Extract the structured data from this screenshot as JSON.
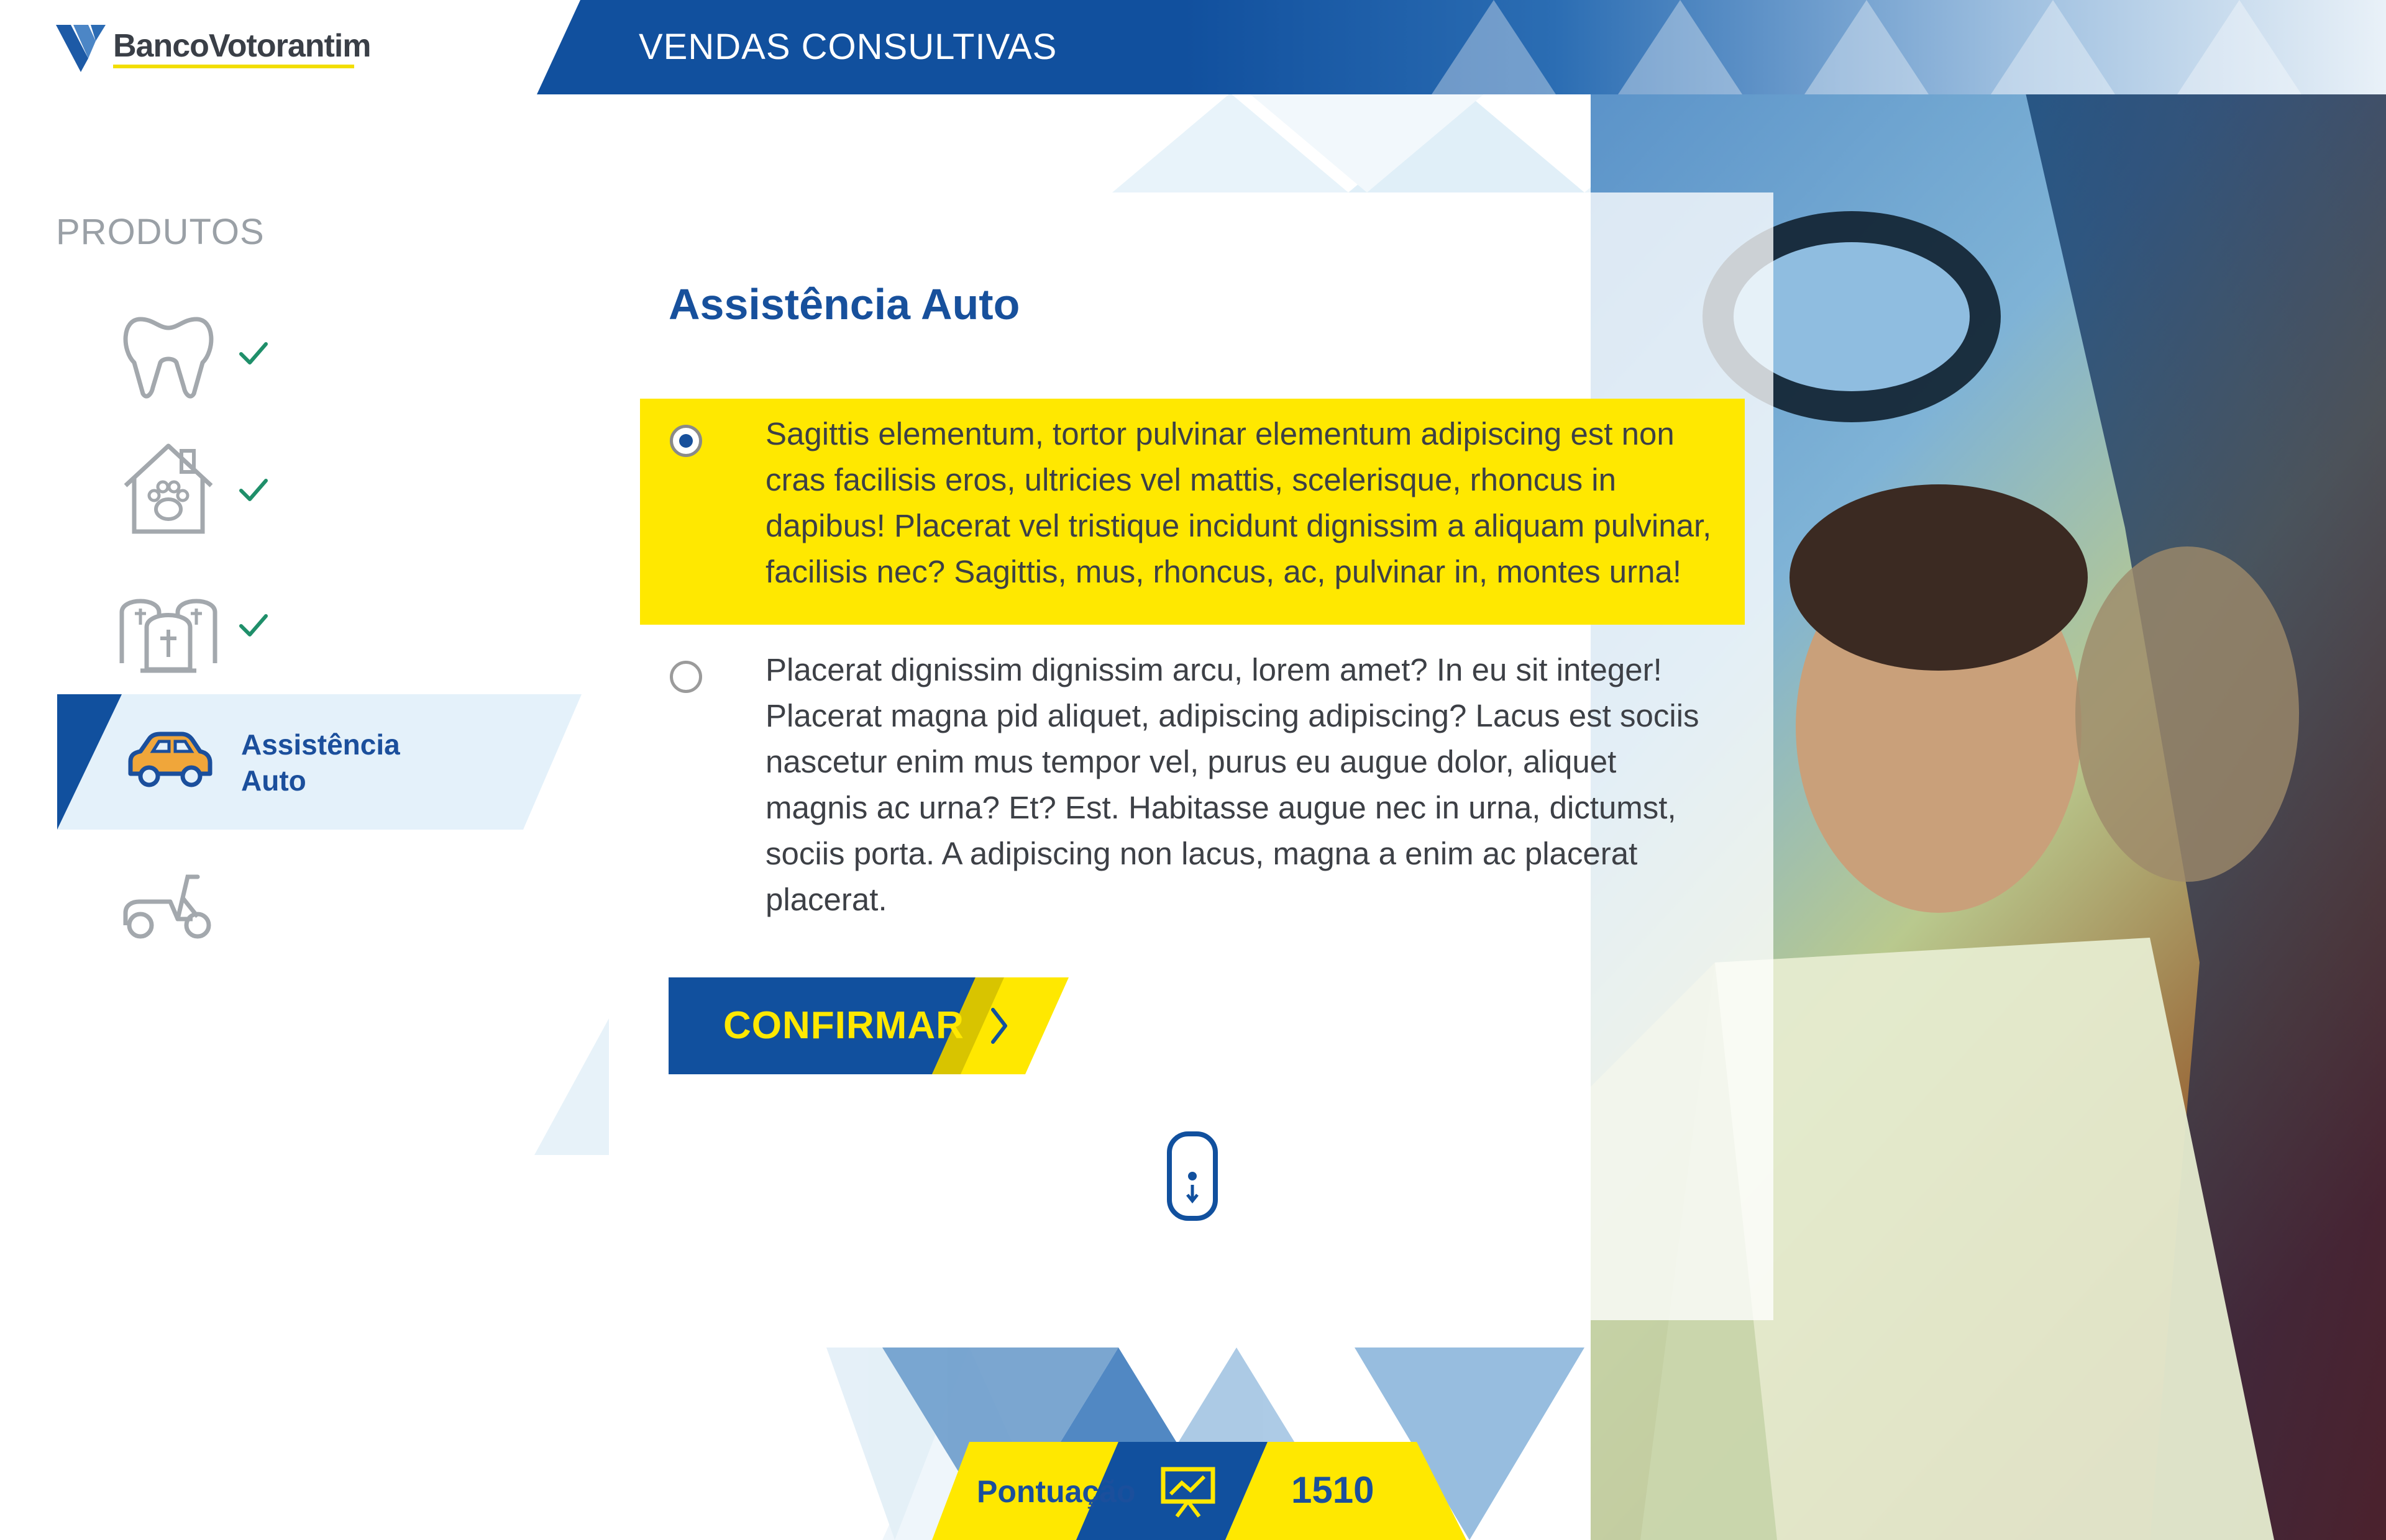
{
  "app": {
    "brand": "BancoVotorantim",
    "title": "VENDAS CONSULTIVAS"
  },
  "sidebar": {
    "section_label": "PRODUTOS",
    "items": [
      {
        "icon": "tooth-icon",
        "completed": true
      },
      {
        "icon": "pet-house-icon",
        "completed": true
      },
      {
        "icon": "tombstones-icon",
        "completed": true
      },
      {
        "icon": "car-icon",
        "label": "Assistência Auto",
        "label_line1": "Assistência",
        "label_line2": "Auto",
        "active": true
      },
      {
        "icon": "scooter-icon",
        "completed": false
      }
    ]
  },
  "question": {
    "title": "Assistência Auto",
    "options": [
      {
        "text": "Sagittis elementum, tortor pulvinar elementum adipiscing est non cras facilisis eros, ultricies vel mattis, scelerisque, rhoncus in dapibus! Placerat vel tristique incidunt dignissim a aliquam pulvinar, facilisis nec? Sagittis, mus, rhoncus, ac, pulvinar in, montes urna!",
        "selected": true
      },
      {
        "text": "Placerat dignissim dignissim arcu, lorem amet? In eu sit integer! Placerat magna pid aliquet, adipiscing adipiscing? Lacus est sociis nascetur enim mus tempor vel, purus eu augue dolor, aliquet magnis ac urna? Et? Est. Habitasse augue nec in urna, dictumst, sociis porta. A adipiscing non lacus, magna a enim ac placerat placerat.",
        "selected": false
      }
    ],
    "confirm_label": "CONFIRMAR"
  },
  "score": {
    "label": "Pontuação",
    "value": "1510"
  },
  "colors": {
    "brand_blue": "#17509c",
    "accent_yellow": "#ffe800",
    "check_green": "#1f8f6a",
    "highlight_bg": "#e4f1fa"
  }
}
